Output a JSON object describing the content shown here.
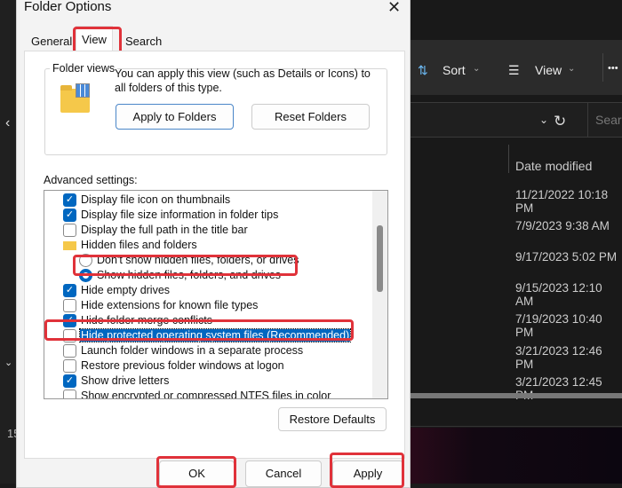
{
  "dialog": {
    "title": "Folder Options",
    "tabs": [
      "General",
      "View",
      "Search"
    ],
    "active_tab": "View",
    "folder_views": {
      "label": "Folder views",
      "description": "You can apply this view (such as Details or Icons) to all folders of this type.",
      "apply_button": "Apply to Folders",
      "reset_button": "Reset Folders"
    },
    "advanced_label": "Advanced settings:",
    "settings": [
      {
        "type": "checkbox",
        "label": "Display file icon on thumbnails",
        "checked": true
      },
      {
        "type": "checkbox",
        "label": "Display file size information in folder tips",
        "checked": true
      },
      {
        "type": "checkbox",
        "label": "Display the full path in the title bar",
        "checked": false
      },
      {
        "type": "folder",
        "label": "Hidden files and folders"
      },
      {
        "type": "radio",
        "label": "Don't show hidden files, folders, or drives",
        "checked": false
      },
      {
        "type": "radio",
        "label": "Show hidden files, folders, and drives",
        "checked": true
      },
      {
        "type": "checkbox",
        "label": "Hide empty drives",
        "checked": true
      },
      {
        "type": "checkbox",
        "label": "Hide extensions for known file types",
        "checked": false
      },
      {
        "type": "checkbox",
        "label": "Hide folder merge conflicts",
        "checked": true
      },
      {
        "type": "checkbox",
        "label": "Hide protected operating system files (Recommended)",
        "checked": false,
        "selected": true
      },
      {
        "type": "checkbox",
        "label": "Launch folder windows in a separate process",
        "checked": false
      },
      {
        "type": "checkbox",
        "label": "Restore previous folder windows at logon",
        "checked": false
      },
      {
        "type": "checkbox",
        "label": "Show drive letters",
        "checked": true
      },
      {
        "type": "checkbox",
        "label": "Show encrypted or compressed NTFS files in color",
        "checked": false
      }
    ],
    "restore_defaults": "Restore Defaults",
    "ok": "OK",
    "cancel": "Cancel",
    "apply": "Apply"
  },
  "explorer": {
    "sort": "Sort",
    "view": "View",
    "more": "•••",
    "search_placeholder": "Search",
    "column": "Date modified",
    "dates": [
      "11/21/2022 10:18 PM",
      "7/9/2023 9:38 AM",
      "9/17/2023 5:02 PM",
      "9/15/2023 12:10 AM",
      "7/19/2023 10:40 PM",
      "3/21/2023 12:46 PM",
      "3/21/2023 12:45 PM"
    ],
    "status_partial": "15"
  },
  "colors": {
    "accent": "#0067c0",
    "highlight": "#e0323a"
  }
}
